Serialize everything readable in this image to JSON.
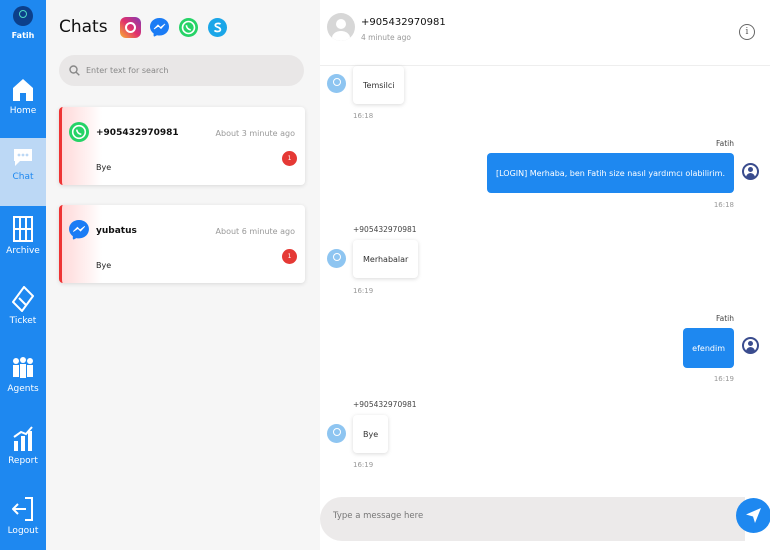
{
  "nav": {
    "user_name": "Fatih",
    "items": [
      {
        "label": "Home",
        "icon": "home-icon"
      },
      {
        "label": "Chat",
        "icon": "chat-icon"
      },
      {
        "label": "Archive",
        "icon": "archive-icon"
      },
      {
        "label": "Ticket",
        "icon": "ticket-icon"
      },
      {
        "label": "Agents",
        "icon": "agents-icon"
      },
      {
        "label": "Report",
        "icon": "report-icon"
      },
      {
        "label": "Logout",
        "icon": "logout-icon"
      }
    ],
    "active": "Chat"
  },
  "chat_list": {
    "title": "Chats",
    "channels": [
      "instagram-icon",
      "messenger-icon",
      "whatsapp-icon",
      "skype-icon"
    ],
    "search_placeholder": "Enter text for search",
    "chats": [
      {
        "name": "+905432970981",
        "time": "About 3 minute ago",
        "last_message": "Bye",
        "unread": "1",
        "channel": "whatsapp-icon"
      },
      {
        "name": "yubatus",
        "time": "About 6 minute ago",
        "last_message": "Bye",
        "unread": "1",
        "channel": "messenger-icon"
      }
    ]
  },
  "conversation": {
    "contact": "+905432970981",
    "last_seen": "4 minute ago",
    "messages": [
      {
        "direction": "in",
        "sender": "",
        "text": "Temsilci",
        "time": "16:18"
      },
      {
        "direction": "out",
        "sender": "Fatih",
        "text": "[LOGIN] Merhaba, ben Fatih size nasıl yardımcı olabilirim.",
        "time": "16:18"
      },
      {
        "direction": "in",
        "sender": "+905432970981",
        "text": "Merhabalar",
        "time": "16:19"
      },
      {
        "direction": "out",
        "sender": "Fatih",
        "text": "efendim",
        "time": "16:19"
      },
      {
        "direction": "in",
        "sender": "+905432970981",
        "text": "Bye",
        "time": "16:19"
      }
    ],
    "composer_placeholder": "Type a message here"
  },
  "colors": {
    "primary": "#1e88f0",
    "unread_badge": "#e53935",
    "whatsapp": "#25d366",
    "messenger": "#1b7cf5",
    "skype": "#1aa6e8"
  }
}
